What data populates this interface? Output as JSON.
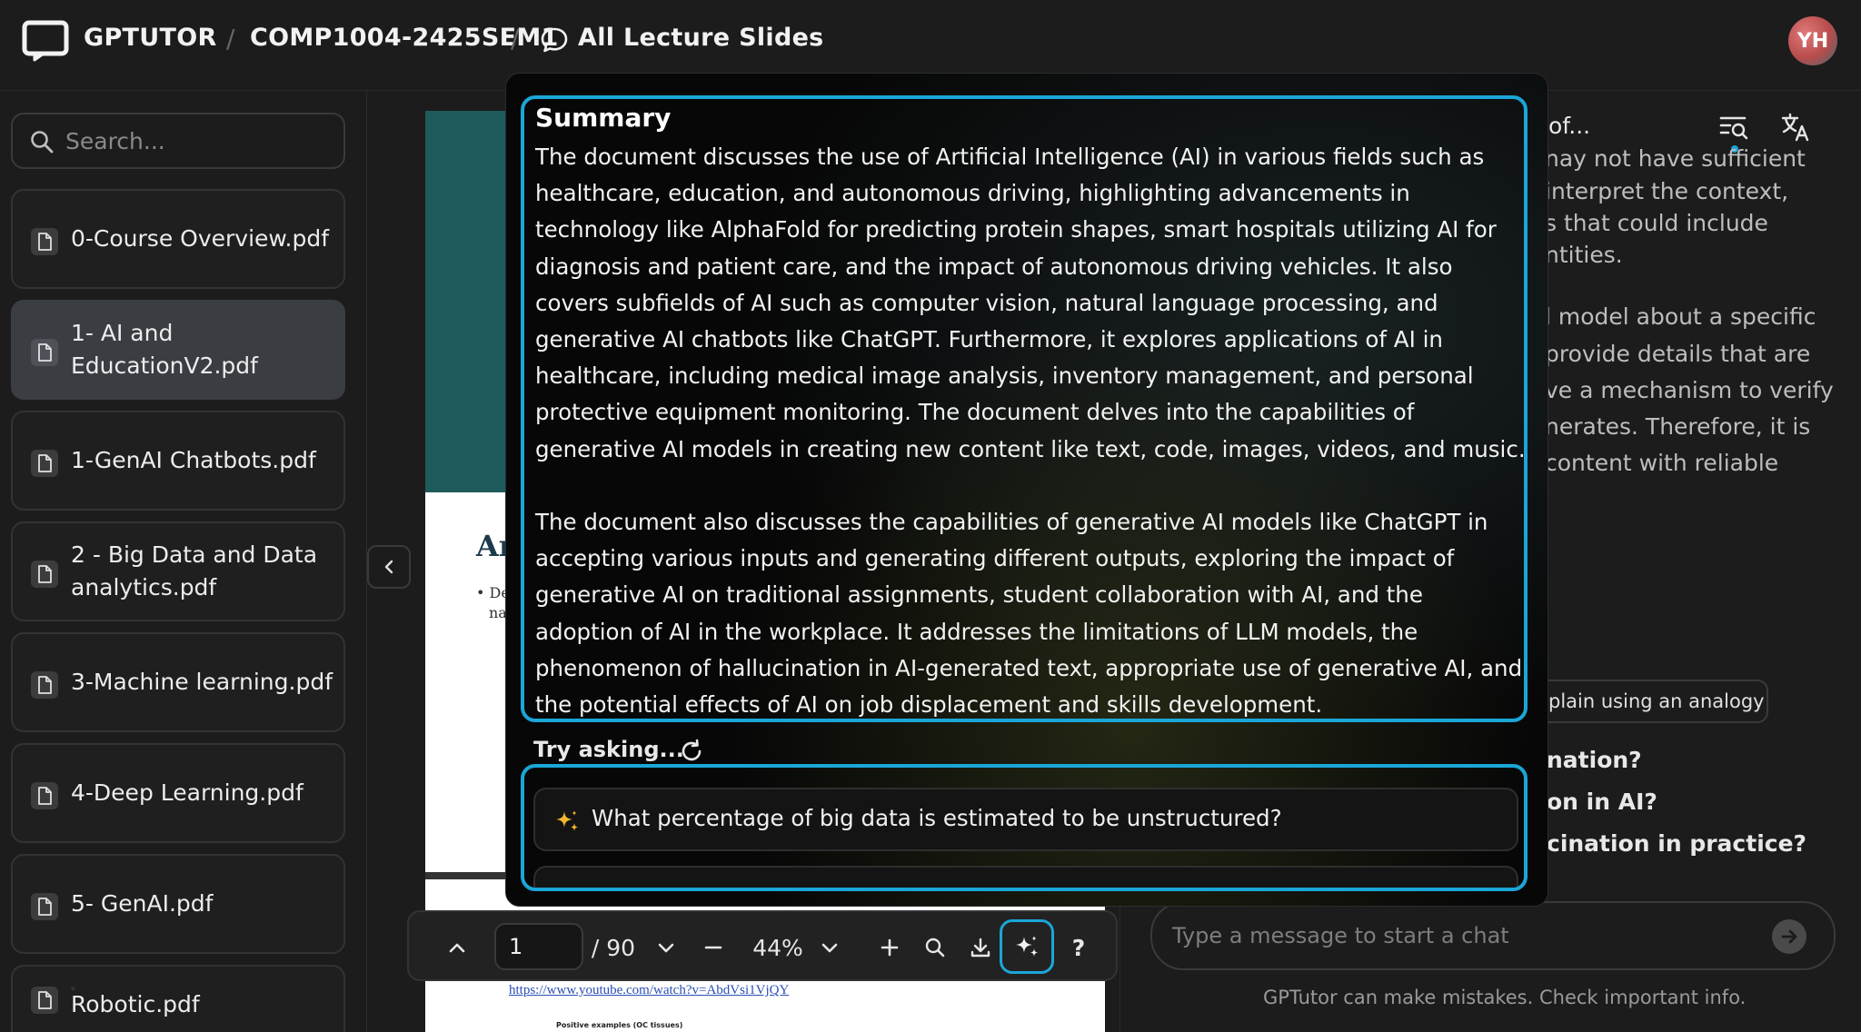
{
  "header": {
    "brand": "GPTUTOR",
    "course": "COMP1004-2425SEM1",
    "section": "All Lecture Slides",
    "avatar_initials": "YH"
  },
  "sidebar": {
    "search_placeholder": "Search...",
    "files": [
      {
        "label": "0-Course Overview.pdf"
      },
      {
        "label": "1- AI and EducationV2.pdf",
        "active": true
      },
      {
        "label": "1-GenAI Chatbots.pdf"
      },
      {
        "label": "2 - Big Data and Data analytics.pdf"
      },
      {
        "label": "3-Machine learning.pdf"
      },
      {
        "label": "4-Deep Learning.pdf"
      },
      {
        "label": "5- GenAI.pdf"
      },
      {
        "label": "Robotic.pdf"
      }
    ]
  },
  "pdf": {
    "title_fragment": "Ar",
    "bullet_fragment": "• De",
    "bullet_fragment2": "na",
    "link": "https://www.youtube.com/watch?v=AbdVsi1VjQY",
    "small_text": "Positive examples (OC tissues)",
    "toolbar": {
      "page": "1",
      "total": "/ 90",
      "zoom": "44%",
      "help": "?"
    }
  },
  "chat": {
    "header_fragment": "of...",
    "lines": [
      "nay not have sufficient",
      "interpret the context,",
      "s that could include",
      "ntities.",
      "l model about a specific",
      "provide details that are",
      "ve a mechanism to verify",
      "nerates. Therefore, it is",
      "content with reliable"
    ],
    "chip": "plain using an analogy",
    "questions": [
      "nation?",
      "on in AI?",
      "cination in practice?"
    ],
    "input_placeholder": "Type a message to start a chat",
    "disclaimer": "GPTutor can make mistakes. Check important info."
  },
  "overlay": {
    "summary_title": "Summary",
    "summary_p1": "The document discusses the use of Artificial Intelligence (AI) in various fields such as healthcare, education, and autonomous driving, highlighting advancements in technology like AlphaFold for predicting protein shapes, smart hospitals utilizing AI for diagnosis and patient care, and the impact of autonomous driving vehicles. It also covers subfields of AI such as computer vision, natural language processing, and generative AI chatbots like ChatGPT. Furthermore, it explores applications of AI in healthcare, including medical image analysis, inventory management, and personal protective equipment monitoring. The document delves into the capabilities of generative AI models in creating new content like text, code, images, videos, and music.",
    "summary_p2": "The document also discusses the capabilities of generative AI models like ChatGPT in accepting various inputs and generating different outputs, exploring the impact of generative AI on traditional assignments, student collaboration with AI, and the adoption of AI in the workplace. It addresses the limitations of LLM models, the phenomenon of hallucination in AI-generated text, appropriate use of generative AI, and the potential effects of AI on job displacement and skills development.",
    "try_asking": "Try asking...",
    "suggestion": "What percentage of big data is estimated to be unstructured?"
  },
  "colors": {
    "accent": "#1ba6d8",
    "banner": "#1f5a5c",
    "background": "#1c1c1c"
  }
}
